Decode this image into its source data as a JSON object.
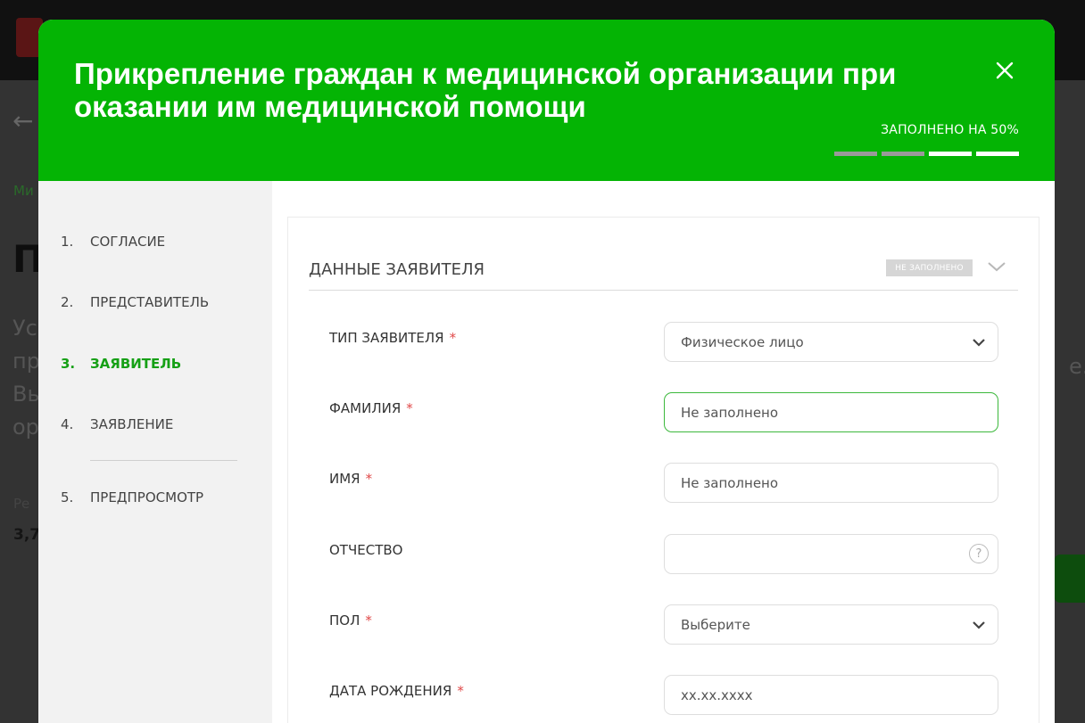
{
  "background": {
    "crumb": "Ми",
    "big_letter": "П",
    "lines": [
      "Ус",
      "пр",
      "Вы",
      "ор"
    ],
    "small": "Ре",
    "number": "3,7",
    "right_dot": "е."
  },
  "modal": {
    "title": "Прикрепление граждан к медицинской организации при оказании им медицинской помощи",
    "progress_label": "ЗАПОЛНЕНО НА 50%",
    "progress": {
      "segments": 4,
      "filled": 2,
      "percent": 50
    }
  },
  "steps": [
    {
      "num": "1.",
      "label": "СОГЛАСИЕ"
    },
    {
      "num": "2.",
      "label": "ПРЕДСТАВИТЕЛЬ"
    },
    {
      "num": "3.",
      "label": "ЗАЯВИТЕЛЬ",
      "active": true
    },
    {
      "num": "4.",
      "label": "ЗАЯВЛЕНИЕ"
    },
    {
      "num": "5.",
      "label": "ПРЕДПРОСМОТР"
    }
  ],
  "section": {
    "title": "ДАННЫЕ ЗАЯВИТЕЛЯ",
    "status": "НЕ ЗАПОЛНЕНО"
  },
  "fields": {
    "type": {
      "label": "ТИП ЗАЯВИТЕЛЯ",
      "required": "*",
      "value": "Физическое лицо"
    },
    "surname": {
      "label": "ФАМИЛИЯ",
      "required": "*",
      "placeholder": "Не заполнено"
    },
    "name": {
      "label": "ИМЯ",
      "required": "*",
      "placeholder": "Не заполнено"
    },
    "patronymic": {
      "label": "ОТЧЕСТВО",
      "help": "?"
    },
    "gender": {
      "label": "ПОЛ",
      "required": "*",
      "value": "Выберите"
    },
    "birthdate": {
      "label": "ДАТА РОЖДЕНИЯ",
      "required": "*",
      "placeholder": "xx.xx.xxxx"
    }
  },
  "colors": {
    "header": "#04b404",
    "active_step": "#16a016",
    "required": "#e04848",
    "focus_border": "#3cb83c"
  }
}
